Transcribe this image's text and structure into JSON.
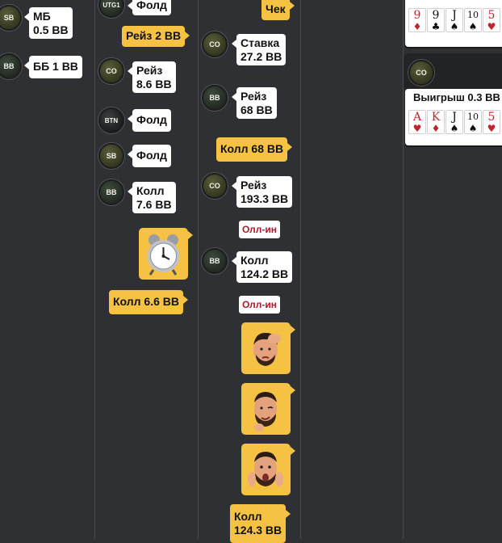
{
  "columns": {
    "col1": {
      "actions": [
        {
          "seat": "SB",
          "text": "МБ\n0.5 BB"
        },
        {
          "seat": "BB",
          "text": "ББ 1 BB"
        }
      ]
    },
    "col2": {
      "actions": [
        {
          "seat": "UTG1",
          "text": "Фолд"
        },
        {
          "bet": "Рейз 2 BB"
        },
        {
          "seat": "CO",
          "text": "Рейз\n8.6 BB"
        },
        {
          "seat": "BTN",
          "text": "Фолд"
        },
        {
          "seat": "SB",
          "text": "Фолд"
        },
        {
          "seat": "BB",
          "text": "Колл\n7.6 BB"
        },
        {
          "sticker": "alarm-clock"
        },
        {
          "bet": "Колл 6.6 BB"
        }
      ]
    },
    "col3": {
      "actions": [
        {
          "bet": "Чек"
        },
        {
          "seat": "CO",
          "text": "Ставка\n27.2 BB"
        },
        {
          "seat": "BB",
          "text": "Рейз\n68 BB"
        },
        {
          "bet": "Колл 68 BB"
        },
        {
          "seat": "CO",
          "text": "Рейз\n193.3 BB",
          "badge": "Олл-ин"
        },
        {
          "seat": "BB",
          "text": "Колл\n124.2 BB",
          "badge": "Олл-ин"
        },
        {
          "sticker": "man-facepalm"
        },
        {
          "sticker": "man-wink"
        },
        {
          "sticker": "man-shocked"
        },
        {
          "bet": "Колл\n124.3 BB"
        }
      ]
    }
  },
  "results": {
    "top_cards": [
      {
        "rank": "9",
        "suit": "♦",
        "color": "red"
      },
      {
        "rank": "9",
        "suit": "♣",
        "color": "black"
      },
      {
        "rank": "J",
        "suit": "♠",
        "color": "black"
      },
      {
        "rank": "10",
        "suit": "♠",
        "color": "black"
      },
      {
        "rank": "5",
        "suit": "♥",
        "color": "red"
      }
    ],
    "winner_seat": "CO",
    "winner_title": "Выигрыш 0.3 BB",
    "winner_cards": [
      {
        "rank": "A",
        "suit": "♥",
        "color": "red"
      },
      {
        "rank": "K",
        "suit": "♦",
        "color": "red"
      },
      {
        "rank": "J",
        "suit": "♠",
        "color": "black"
      },
      {
        "rank": "10",
        "suit": "♠",
        "color": "black"
      },
      {
        "rank": "5",
        "suit": "♥",
        "color": "red"
      }
    ]
  }
}
